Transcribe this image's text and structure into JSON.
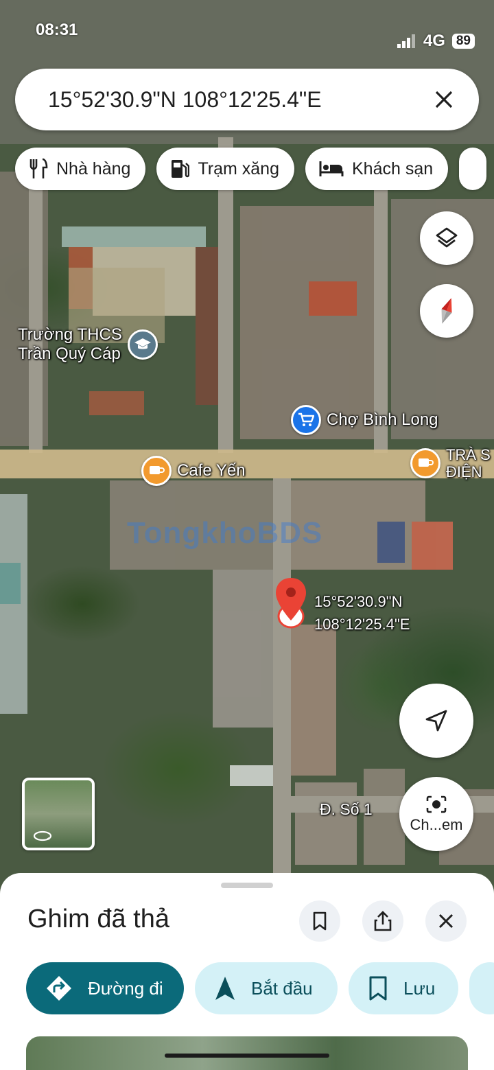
{
  "status_bar": {
    "time": "08:31",
    "network": "4G",
    "battery": "89"
  },
  "search": {
    "query": "15°52'30.9\"N 108°12'25.4\"E"
  },
  "chips": [
    {
      "label": "Nhà hàng",
      "icon": "restaurant-icon"
    },
    {
      "label": "Trạm xăng",
      "icon": "gas-station-icon"
    },
    {
      "label": "Khách sạn",
      "icon": "hotel-icon"
    }
  ],
  "map": {
    "pois": [
      {
        "name": "Trường THCS Trần Quý Cáp",
        "line1": "Trường THCS",
        "line2": "Trần Quý Cáp",
        "icon": "school-icon",
        "color": "#5a7a8c"
      },
      {
        "name": "Chợ Bình Long",
        "icon": "shopping-cart-icon",
        "color": "#1a73e8"
      },
      {
        "name": "Cafe Yến",
        "icon": "cafe-icon",
        "color": "#f29a2e"
      },
      {
        "line1": "TRÀ S",
        "line2": "ĐIỆN",
        "icon": "cafe-icon",
        "color": "#f29a2e"
      }
    ],
    "street_label": "Đ. Số 1",
    "pin_coords": {
      "line1": "15°52'30.9\"N",
      "line2": "108°12'25.4\"E"
    },
    "watermark": "TongkhoBDS"
  },
  "search_with_photo_label": "Ch...em",
  "sheet": {
    "title": "Ghim đã thả",
    "actions": [
      {
        "label": "Đường đi",
        "icon": "directions-icon"
      },
      {
        "label": "Bắt đầu",
        "icon": "navigation-arrow-icon"
      },
      {
        "label": "Lưu",
        "icon": "bookmark-icon"
      }
    ]
  },
  "colors": {
    "primary": "#0b6a7a",
    "secondary": "#d4f1f7",
    "pin_red": "#ea4335"
  }
}
